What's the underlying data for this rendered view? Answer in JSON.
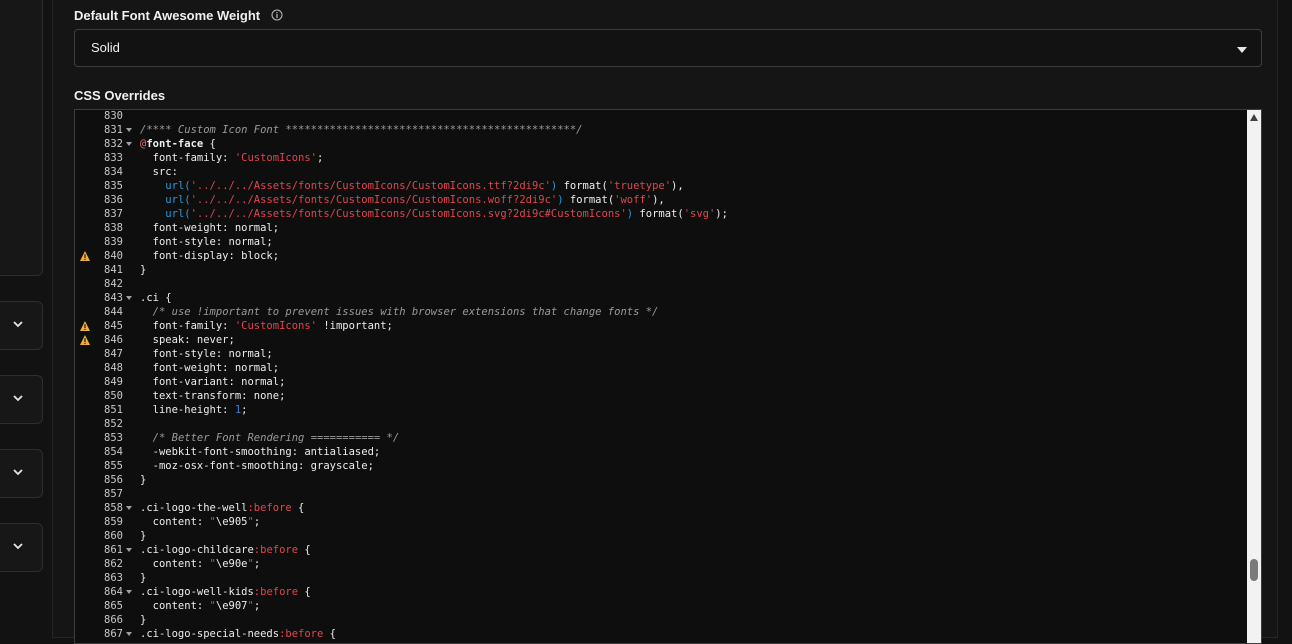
{
  "font_weight": {
    "label": "Default Font Awesome Weight",
    "value": "Solid",
    "info_icon": "info-circle-icon"
  },
  "css_overrides": {
    "label": "CSS Overrides",
    "lines": [
      {
        "n": "830",
        "fold": false,
        "warn": false,
        "tokens": []
      },
      {
        "n": "831",
        "fold": true,
        "warn": false,
        "tokens": [
          [
            "c",
            "/**** Custom Icon Font **********************************************/"
          ]
        ]
      },
      {
        "n": "832",
        "fold": true,
        "warn": false,
        "tokens": [
          [
            "at",
            "@"
          ],
          [
            "b",
            "font-face"
          ],
          [
            "p",
            " {"
          ]
        ]
      },
      {
        "n": "833",
        "fold": false,
        "warn": false,
        "tokens": [
          [
            "p",
            "  font-family: "
          ],
          [
            "s",
            "'CustomIcons'"
          ],
          [
            "p",
            ";"
          ]
        ]
      },
      {
        "n": "834",
        "fold": false,
        "warn": false,
        "tokens": [
          [
            "p",
            "  src:"
          ]
        ]
      },
      {
        "n": "835",
        "fold": false,
        "warn": false,
        "tokens": [
          [
            "p",
            "    "
          ],
          [
            "u",
            "url("
          ],
          [
            "s",
            "'../../../Assets/fonts/CustomIcons/CustomIcons.ttf?2di9c'"
          ],
          [
            "u",
            ")"
          ],
          [
            "p",
            " format("
          ],
          [
            "s",
            "'truetype'"
          ],
          [
            "p",
            "),"
          ]
        ]
      },
      {
        "n": "836",
        "fold": false,
        "warn": false,
        "tokens": [
          [
            "p",
            "    "
          ],
          [
            "u",
            "url("
          ],
          [
            "s",
            "'../../../Assets/fonts/CustomIcons/CustomIcons.woff?2di9c'"
          ],
          [
            "u",
            ")"
          ],
          [
            "p",
            " format("
          ],
          [
            "s",
            "'woff'"
          ],
          [
            "p",
            "),"
          ]
        ]
      },
      {
        "n": "837",
        "fold": false,
        "warn": false,
        "tokens": [
          [
            "p",
            "    "
          ],
          [
            "u",
            "url("
          ],
          [
            "s",
            "'../../../Assets/fonts/CustomIcons/CustomIcons.svg?2di9c#CustomIcons'"
          ],
          [
            "u",
            ")"
          ],
          [
            "p",
            " format("
          ],
          [
            "s",
            "'svg'"
          ],
          [
            "p",
            ");"
          ]
        ]
      },
      {
        "n": "838",
        "fold": false,
        "warn": false,
        "tokens": [
          [
            "p",
            "  font-weight: normal;"
          ]
        ]
      },
      {
        "n": "839",
        "fold": false,
        "warn": false,
        "tokens": [
          [
            "p",
            "  font-style: normal;"
          ]
        ]
      },
      {
        "n": "840",
        "fold": false,
        "warn": true,
        "tokens": [
          [
            "p",
            "  font-display: block;"
          ]
        ]
      },
      {
        "n": "841",
        "fold": false,
        "warn": false,
        "tokens": [
          [
            "p",
            "}"
          ]
        ]
      },
      {
        "n": "842",
        "fold": false,
        "warn": false,
        "tokens": []
      },
      {
        "n": "843",
        "fold": true,
        "warn": false,
        "tokens": [
          [
            "p",
            ".ci {"
          ]
        ]
      },
      {
        "n": "844",
        "fold": false,
        "warn": false,
        "tokens": [
          [
            "p",
            "  "
          ],
          [
            "c",
            "/* use !important to prevent issues with browser extensions that change fonts */"
          ]
        ]
      },
      {
        "n": "845",
        "fold": false,
        "warn": true,
        "tokens": [
          [
            "p",
            "  font-family: "
          ],
          [
            "s",
            "'CustomIcons'"
          ],
          [
            "p",
            " !important;"
          ]
        ]
      },
      {
        "n": "846",
        "fold": false,
        "warn": true,
        "tokens": [
          [
            "p",
            "  speak: never;"
          ]
        ]
      },
      {
        "n": "847",
        "fold": false,
        "warn": false,
        "tokens": [
          [
            "p",
            "  font-style: normal;"
          ]
        ]
      },
      {
        "n": "848",
        "fold": false,
        "warn": false,
        "tokens": [
          [
            "p",
            "  font-weight: normal;"
          ]
        ]
      },
      {
        "n": "849",
        "fold": false,
        "warn": false,
        "tokens": [
          [
            "p",
            "  font-variant: normal;"
          ]
        ]
      },
      {
        "n": "850",
        "fold": false,
        "warn": false,
        "tokens": [
          [
            "p",
            "  text-transform: none;"
          ]
        ]
      },
      {
        "n": "851",
        "fold": false,
        "warn": false,
        "tokens": [
          [
            "p",
            "  line-height: "
          ],
          [
            "num",
            "1"
          ],
          [
            "p",
            ";"
          ]
        ]
      },
      {
        "n": "852",
        "fold": false,
        "warn": false,
        "tokens": []
      },
      {
        "n": "853",
        "fold": false,
        "warn": false,
        "tokens": [
          [
            "p",
            "  "
          ],
          [
            "c",
            "/* Better Font Rendering =========== */"
          ]
        ]
      },
      {
        "n": "854",
        "fold": false,
        "warn": false,
        "tokens": [
          [
            "p",
            "  -webkit-font-smoothing: antialiased;"
          ]
        ]
      },
      {
        "n": "855",
        "fold": false,
        "warn": false,
        "tokens": [
          [
            "p",
            "  -moz-osx-font-smoothing: grayscale;"
          ]
        ]
      },
      {
        "n": "856",
        "fold": false,
        "warn": false,
        "tokens": [
          [
            "p",
            "}"
          ]
        ]
      },
      {
        "n": "857",
        "fold": false,
        "warn": false,
        "tokens": []
      },
      {
        "n": "858",
        "fold": true,
        "warn": false,
        "tokens": [
          [
            "p",
            ".ci-logo-the-well"
          ],
          [
            "ps",
            ":before"
          ],
          [
            "p",
            " {"
          ]
        ]
      },
      {
        "n": "859",
        "fold": false,
        "warn": false,
        "tokens": [
          [
            "p",
            "  content: "
          ],
          [
            "s",
            "\""
          ],
          [
            "p",
            "\\e905"
          ],
          [
            "s",
            "\""
          ],
          [
            "p",
            ";"
          ]
        ]
      },
      {
        "n": "860",
        "fold": false,
        "warn": false,
        "tokens": [
          [
            "p",
            "}"
          ]
        ]
      },
      {
        "n": "861",
        "fold": true,
        "warn": false,
        "tokens": [
          [
            "p",
            ".ci-logo-childcare"
          ],
          [
            "ps",
            ":before"
          ],
          [
            "p",
            " {"
          ]
        ]
      },
      {
        "n": "862",
        "fold": false,
        "warn": false,
        "tokens": [
          [
            "p",
            "  content: "
          ],
          [
            "s",
            "\""
          ],
          [
            "p",
            "\\e90e"
          ],
          [
            "s",
            "\""
          ],
          [
            "p",
            ";"
          ]
        ]
      },
      {
        "n": "863",
        "fold": false,
        "warn": false,
        "tokens": [
          [
            "p",
            "}"
          ]
        ]
      },
      {
        "n": "864",
        "fold": true,
        "warn": false,
        "tokens": [
          [
            "p",
            ".ci-logo-well-kids"
          ],
          [
            "ps",
            ":before"
          ],
          [
            "p",
            " {"
          ]
        ]
      },
      {
        "n": "865",
        "fold": false,
        "warn": false,
        "tokens": [
          [
            "p",
            "  content: "
          ],
          [
            "s",
            "\""
          ],
          [
            "p",
            "\\e907"
          ],
          [
            "s",
            "\""
          ],
          [
            "p",
            ";"
          ]
        ]
      },
      {
        "n": "866",
        "fold": false,
        "warn": false,
        "tokens": [
          [
            "p",
            "}"
          ]
        ]
      },
      {
        "n": "867",
        "fold": true,
        "warn": false,
        "tokens": [
          [
            "p",
            ".ci-logo-special-needs"
          ],
          [
            "ps",
            ":before"
          ],
          [
            "p",
            " {"
          ]
        ]
      }
    ]
  },
  "left_sidebar": {
    "accordion_icon": "chevron-down-icon",
    "accordion_count": 4
  },
  "colors": {
    "background": "#121212",
    "comment": "#9b9b9b",
    "string": "#e0454f",
    "url": "#2f98d8",
    "number": "#3f7fd8",
    "warning": "#f0ad3a",
    "scrollbar": "#f2f2f2"
  }
}
